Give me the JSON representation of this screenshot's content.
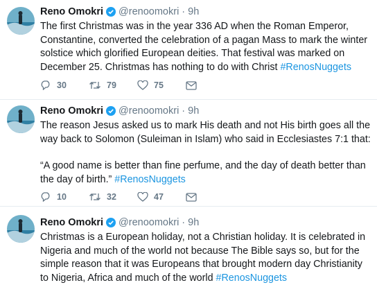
{
  "tweets": [
    {
      "name": "Reno Omokri",
      "handle": "@renoomokri",
      "separator": "·",
      "time": "9h",
      "paragraphs": [
        "The first Christmas was in the year 336 AD when the Roman Emperor, Constantine, converted the celebration of a pagan Mass to mark the winter solstice which glorified European deities. That festival was marked on December 25. Christmas has nothing to do with Christ"
      ],
      "hashtag": "#RenosNuggets",
      "replies": "30",
      "retweets": "79",
      "likes": "75"
    },
    {
      "name": "Reno Omokri",
      "handle": "@renoomokri",
      "separator": "·",
      "time": "9h",
      "paragraphs": [
        "The reason Jesus asked us to mark His death and not His birth goes all the way back to Solomon (Suleiman in Islam) who said in Ecclesiastes 7:1 that:",
        "“A good name is better than fine perfume, and the day of death better than the day of birth.”"
      ],
      "hashtag": "#RenosNuggets",
      "replies": "10",
      "retweets": "32",
      "likes": "47"
    },
    {
      "name": "Reno Omokri",
      "handle": "@renoomokri",
      "separator": "·",
      "time": "9h",
      "paragraphs": [
        "Christmas is a European holiday, not a Christian holiday. It is celebrated in Nigeria and much of the world not because The Bible says so, but for the simple reason that it was Europeans that brought modern day Christianity to Nigeria, Africa and much of the world"
      ],
      "hashtag": "#RenosNuggets"
    }
  ],
  "icons": {
    "reply": "reply-icon",
    "retweet": "retweet-icon",
    "like": "heart-icon",
    "dm": "envelope-icon",
    "verified": "verified-badge-icon"
  },
  "colors": {
    "link": "#1b95e0",
    "muted": "#657786",
    "verified": "#1da1f2",
    "divider": "#e6ecf0"
  }
}
